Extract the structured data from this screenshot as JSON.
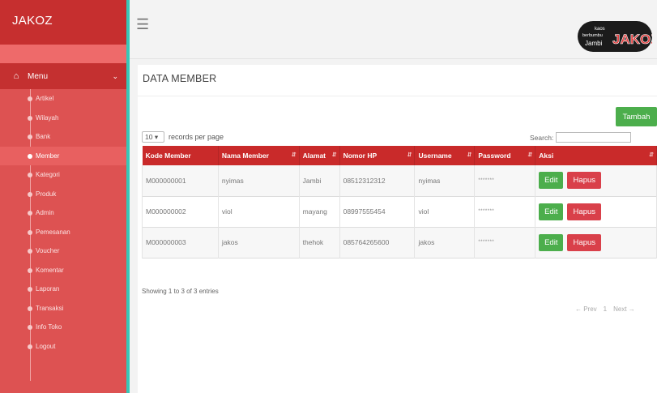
{
  "app": {
    "brand": "JAKOZ"
  },
  "sidebar": {
    "menu_label": "Menu",
    "items": [
      {
        "label": "Artikel",
        "active": false
      },
      {
        "label": "Wilayah",
        "active": false
      },
      {
        "label": "Bank",
        "active": false
      },
      {
        "label": "Member",
        "active": true
      },
      {
        "label": "Kategori",
        "active": false
      },
      {
        "label": "Produk",
        "active": false
      },
      {
        "label": "Admin",
        "active": false
      },
      {
        "label": "Pemesanan",
        "active": false
      },
      {
        "label": "Voucher",
        "active": false
      },
      {
        "label": "Komentar",
        "active": false
      },
      {
        "label": "Laporan",
        "active": false
      },
      {
        "label": "Transaksi",
        "active": false
      },
      {
        "label": "Info Toko",
        "active": false
      },
      {
        "label": "Logout",
        "active": false
      }
    ]
  },
  "logo": {
    "line1": "kaos",
    "line2": "berbumbu",
    "line3": "Jambi",
    "big": "JAKOZ"
  },
  "page": {
    "title": "DATA MEMBER",
    "add_button": "Tambah",
    "length_value": "10",
    "length_label": "records per page",
    "search_label": "Search:",
    "info": "Showing 1 to 3 of 3 entries",
    "pager": {
      "prev": "← Prev",
      "page": "1",
      "next": "Next →"
    }
  },
  "table": {
    "columns": [
      "Kode Member",
      "Nama Member",
      "Alamat",
      "Nomor HP",
      "Username",
      "Password",
      "Aksi"
    ],
    "rows": [
      {
        "kode": "M000000001",
        "nama": "nyimas",
        "alamat": "Jambi",
        "hp": "08512312312",
        "username": "nyimas",
        "password": "*******"
      },
      {
        "kode": "M000000002",
        "nama": "viol",
        "alamat": "mayang",
        "hp": "08997555454",
        "username": "viol",
        "password": "*******"
      },
      {
        "kode": "M000000003",
        "nama": "jakos",
        "alamat": "thehok",
        "hp": "085764265600",
        "username": "jakos",
        "password": "*******"
      }
    ],
    "edit_label": "Edit",
    "delete_label": "Hapus"
  },
  "colors": {
    "sidebar": "#dd5252",
    "brand_bar": "#c62f2f",
    "table_header": "#c92a2a",
    "success": "#4cae4c",
    "danger": "#d9404a",
    "sidebar_accent": "#39c6b6"
  },
  "icons": {
    "menu_toggle": "hamburger-icon",
    "home": "home-icon",
    "chevron": "chevron-down-icon",
    "sort": "sort-icon"
  }
}
